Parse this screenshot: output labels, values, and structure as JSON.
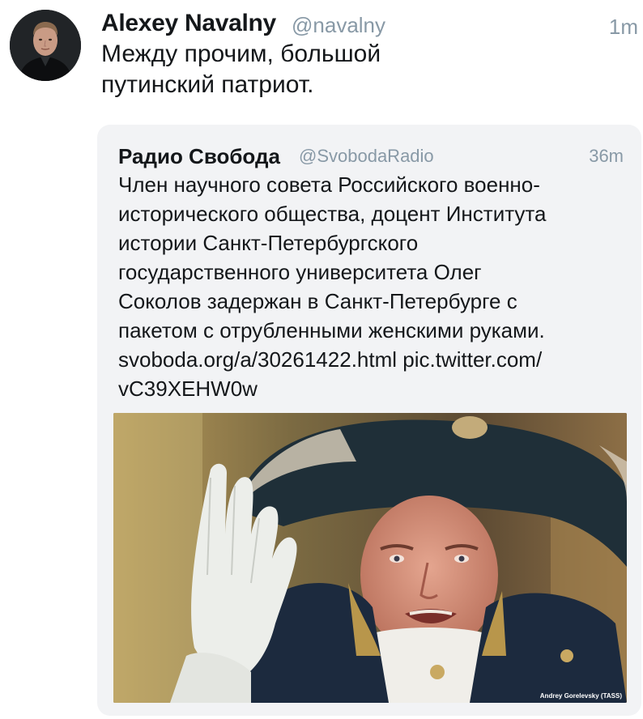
{
  "tweet": {
    "author_name": "Alexey Navalny",
    "author_handle": "@navalny",
    "timestamp": "1m",
    "text_lines": [
      "Между прочим, большой",
      "путинский патриот."
    ]
  },
  "quoted_tweet": {
    "author_name": "Радио Свобода",
    "author_handle": "@SvobodaRadio",
    "timestamp": "36m",
    "text_lines": [
      "Член научного совета Российского военно-",
      "исторического общества, доцент Института",
      "истории Санкт-Петербургского",
      "государственного университета Олег",
      "Соколов задержан в Санкт-Петербурге с",
      "пакетом с отрубленными женскими руками.",
      "svoboda.org/a/30261422.html pic.twitter.com/",
      "vC39XEHW0w"
    ],
    "image_credit": "Andrey Gorelevsky (TASS)"
  },
  "colors": {
    "primary_text": "#14171a",
    "secondary_text": "#8899a6",
    "quote_background": "#f2f3f5"
  },
  "icons": {
    "avatar": "profile-photo",
    "media": "photo-man-in-bicorne-hat"
  }
}
